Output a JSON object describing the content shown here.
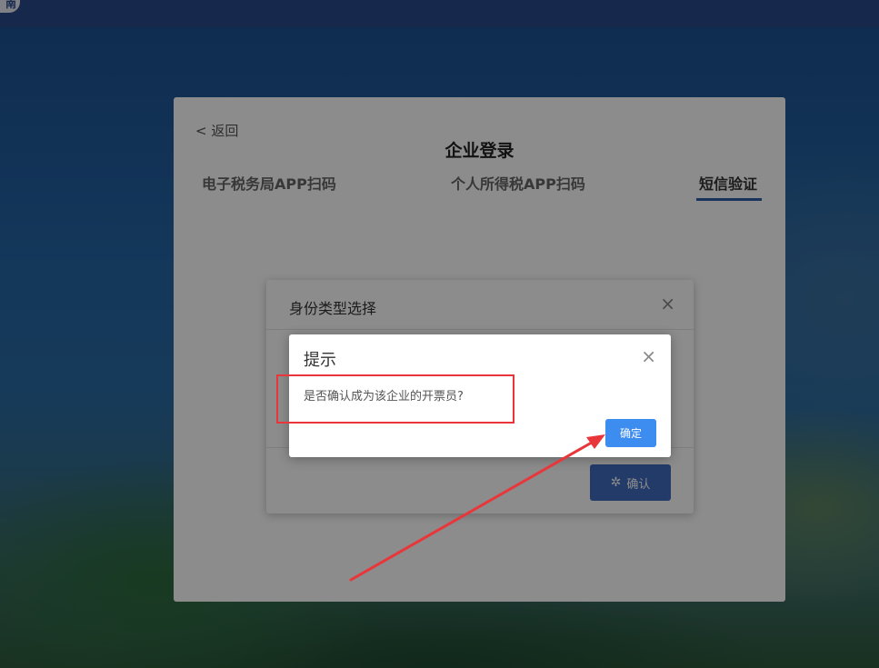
{
  "header": {
    "badge_text": "南"
  },
  "login_panel": {
    "back_label": "< 返回",
    "title": "企业登录",
    "tabs": [
      {
        "label": "电子税务局APP扫码",
        "active": false
      },
      {
        "label": "个人所得税APP扫码",
        "active": false
      },
      {
        "label": "短信验证",
        "active": true
      }
    ]
  },
  "identity_dialog": {
    "title": "身份类型选择",
    "close_icon": "close-icon",
    "confirm_label": "确认",
    "confirm_icon": "loading-spinner-icon"
  },
  "prompt_dialog": {
    "title": "提示",
    "message": "是否确认成为该企业的开票员?",
    "ok_label": "确定",
    "close_icon": "close-icon"
  },
  "annotations": {
    "highlight_color": "#e8363a",
    "arrow_color": "#e8363a"
  },
  "colors": {
    "accent": "#2f5ea8",
    "primary_button": "#3d8cf0",
    "disabled_button": "#3e6cc0"
  }
}
